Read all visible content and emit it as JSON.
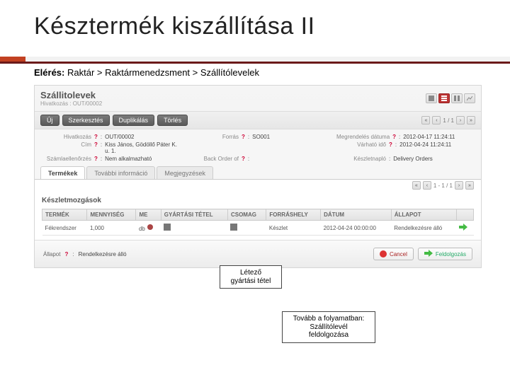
{
  "slide": {
    "title": "Késztermék kiszállítása II",
    "breadcrumb_label": "Elérés:",
    "breadcrumb_path": "Raktár > Raktármenedzsment > Szállítólevelek"
  },
  "app": {
    "heading": "Szállitolevek",
    "ref_label": "Hivatkozás",
    "ref_value": "OUT/00002",
    "buttons": {
      "new": "Új",
      "edit": "Szerkesztés",
      "dup": "Duplikálás",
      "del": "Törlés"
    },
    "pager": "1 / 1"
  },
  "form": {
    "c1": {
      "reference_l": "Hivatkozás",
      "reference_v": "OUT/00002",
      "address_l": "Cím",
      "address_v": "Kiss János, Gödöllő Páter K. u. 1.",
      "invoice_l": "Számlaellenőrzés",
      "invoice_v": "Nem alkalmazható"
    },
    "c2": {
      "source_l": "Forrás",
      "source_v": "SO001",
      "backorder_l": "Back Order of",
      "backorder_v": ""
    },
    "c3": {
      "orderdate_l": "Megrendelés dátuma",
      "orderdate_v": "2012-04-17 11:24:11",
      "expect_l": "Várható idő",
      "expect_v": "2012-04-24 11:24:11",
      "log_l": "Készletnapló",
      "log_v": "Delivery Orders"
    }
  },
  "tabs": {
    "t1": "Termékek",
    "t2": "További információ",
    "t3": "Megjegyzések"
  },
  "section_title": "Készletmozgások",
  "table": {
    "headers": {
      "product": "TERMÉK",
      "qty": "MENNYISÉG",
      "uom": "ME",
      "lot": "GYÁRTÁSI TÉTEL",
      "pack": "CSOMAG",
      "srcloc": "FORRÁSHELY",
      "date": "DÁTUM",
      "state": "ÁLLAPOT"
    },
    "row": {
      "product": "Fékrendszer",
      "qty": "1,000",
      "uom": "db",
      "lot": "",
      "pack": "",
      "srcloc": "Készlet",
      "date": "2012-04-24 00:00:00",
      "state": "Rendelkezésre álló"
    },
    "pager": "1 - 1 / 1"
  },
  "footer": {
    "state_l": "Állapot",
    "state_v": "Rendelkezésre álló",
    "cancel": "Cancel",
    "process": "Feldolgozás"
  },
  "callouts": {
    "lot": "Létező\ngyártási tétel",
    "process": "Tovább a folyamatban:\nSzállítólevél\nfeldolgozása"
  }
}
